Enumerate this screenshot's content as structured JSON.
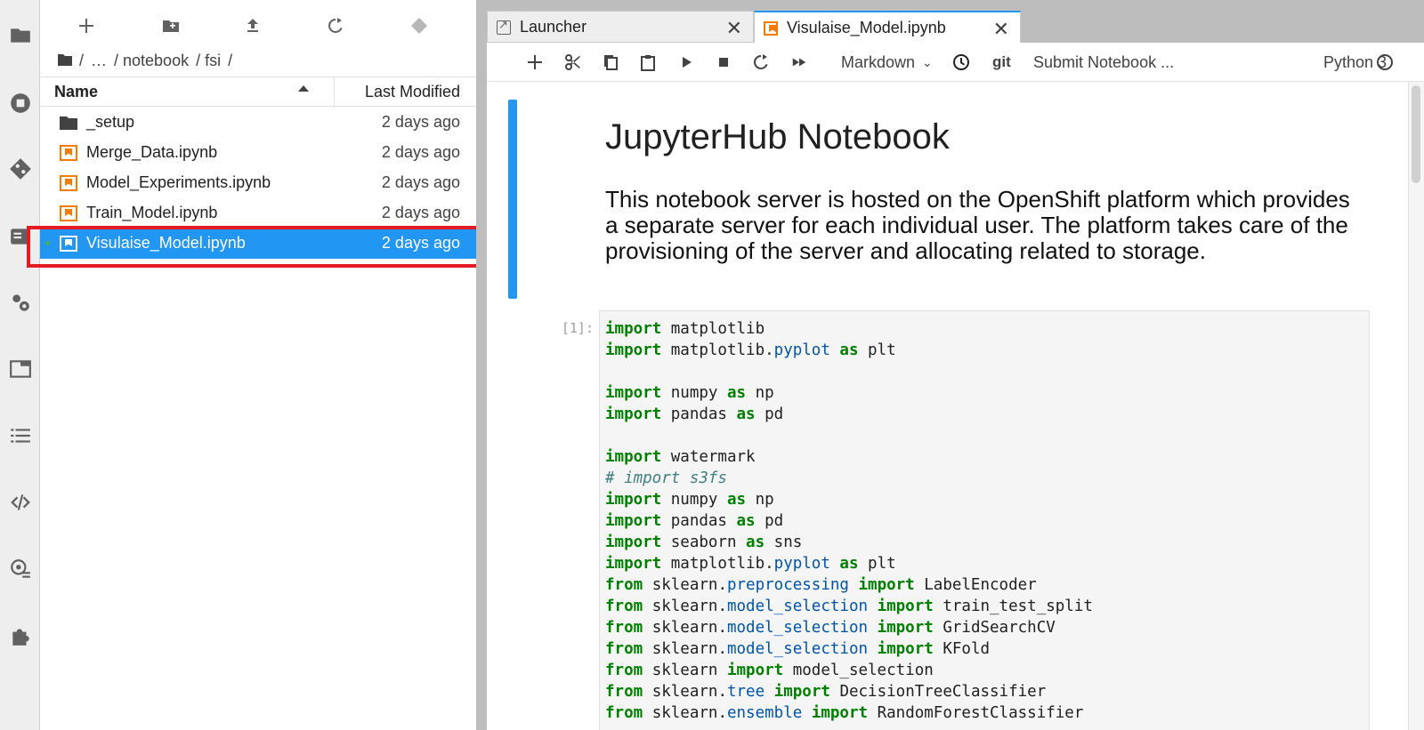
{
  "activity_bar": {
    "icons": [
      "folder-icon",
      "running-icon",
      "git-icon",
      "commands-icon",
      "property-inspector-icon",
      "tabs-icon",
      "toc-icon",
      "code-snippets-icon",
      "settings-icon",
      "extensions-icon"
    ]
  },
  "file_browser": {
    "toolbar": [
      "new-launcher-icon",
      "new-folder-icon",
      "upload-icon",
      "refresh-icon",
      "git-clone-icon"
    ],
    "breadcrumb": [
      "/",
      "…",
      "/ notebook",
      "/ fsi",
      "/"
    ],
    "columns": {
      "name": "Name",
      "modified": "Last Modified"
    },
    "files": [
      {
        "name": "_setup",
        "type": "directory",
        "modified": "2 days ago"
      },
      {
        "name": "Merge_Data.ipynb",
        "type": "notebook",
        "modified": "2 days ago"
      },
      {
        "name": "Model_Experiments.ipynb",
        "type": "notebook",
        "modified": "2 days ago"
      },
      {
        "name": "Train_Model.ipynb",
        "type": "notebook",
        "modified": "2 days ago"
      },
      {
        "name": "Visulaise_Model.ipynb",
        "type": "notebook",
        "modified": "2 days ago",
        "selected": true,
        "running": true
      }
    ]
  },
  "tabs": [
    {
      "label": "Launcher",
      "close": "✕"
    },
    {
      "label": "Visulaise_Model.ipynb",
      "close": "✕",
      "active": true
    }
  ],
  "notebook_toolbar": {
    "cell_type": "Markdown",
    "git": "git",
    "submit": "Submit Notebook ...",
    "kernel": "Python 3"
  },
  "notebook": {
    "title": "JupyterHub Notebook",
    "paragraph": "This notebook server is hosted on the OpenShift platform which provides a separate server for each individual user. The platform takes care of the provisioning of the server and allocating related to storage.",
    "prompt": "[1]:"
  },
  "accent": "#2196f3",
  "highlight_color": "#e41b23"
}
